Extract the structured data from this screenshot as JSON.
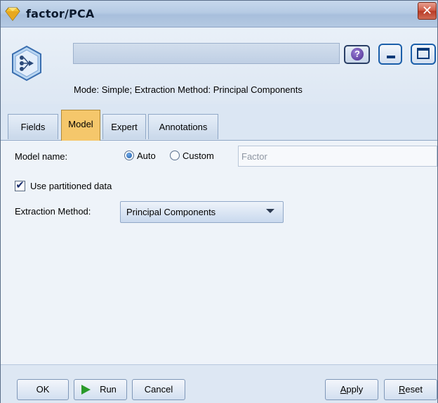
{
  "window": {
    "title": "factor/PCA",
    "close_glyph": "✕"
  },
  "header": {
    "node_icon": "factor-pca-node-icon",
    "name_value": "",
    "help_glyph": "?",
    "mode_text": "Mode: Simple; Extraction Method: Principal Components"
  },
  "tabs": [
    {
      "label": "Fields",
      "active": false
    },
    {
      "label": "Model",
      "active": true
    },
    {
      "label": "Expert",
      "active": false
    },
    {
      "label": "Annotations",
      "active": false
    }
  ],
  "model_tab": {
    "model_name_label": "Model name:",
    "auto_label": "Auto",
    "custom_label": "Custom",
    "selected_mode": "Auto",
    "custom_name_placeholder": "Factor",
    "use_partitioned_label": "Use partitioned data",
    "use_partitioned_checked": true,
    "extraction_label": "Extraction Method:",
    "extraction_value": "Principal Components"
  },
  "footer": {
    "ok": "OK",
    "run": "Run",
    "cancel": "Cancel",
    "apply_key": "A",
    "apply_rest": "pply",
    "reset_key": "R",
    "reset_rest": "eset"
  },
  "colors": {
    "active_tab": "#f5c76b",
    "run_icon": "#2a9a2a",
    "close_button": "#cd5540"
  }
}
